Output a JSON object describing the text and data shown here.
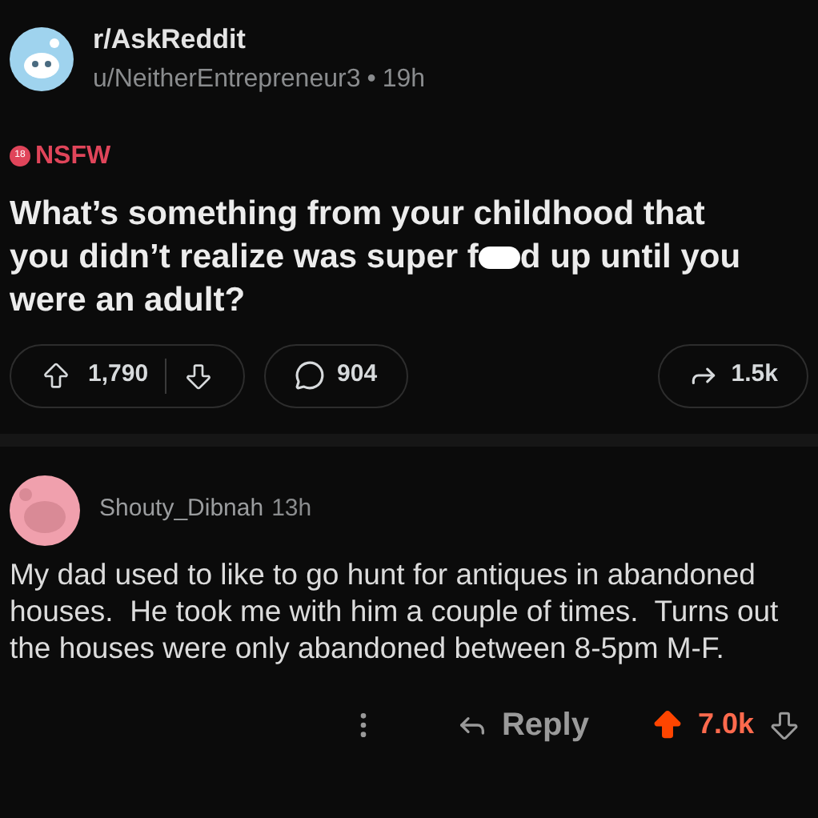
{
  "post": {
    "subreddit": "r/AskReddit",
    "author": "u/NeitherEntrepreneur3",
    "separator": "•",
    "age": "19h",
    "nsfw": "NSFW",
    "nsfw_badge": "18",
    "title_parts": [
      "What’s something from your childhood that you didn’t realize was super f",
      "d up until you were an adult?"
    ],
    "upvotes": "1,790",
    "comments": "904",
    "shares": "1.5k"
  },
  "comment": {
    "author": "Shouty_Dibnah",
    "age": "13h",
    "body": "My dad used to like to go hunt for antiques in abandoned houses.  He took me with him a couple of times.  Turns out the houses were only abandoned between 8-5pm M-F.",
    "reply": "Reply",
    "score": "7.0k",
    "upvoted": true
  }
}
